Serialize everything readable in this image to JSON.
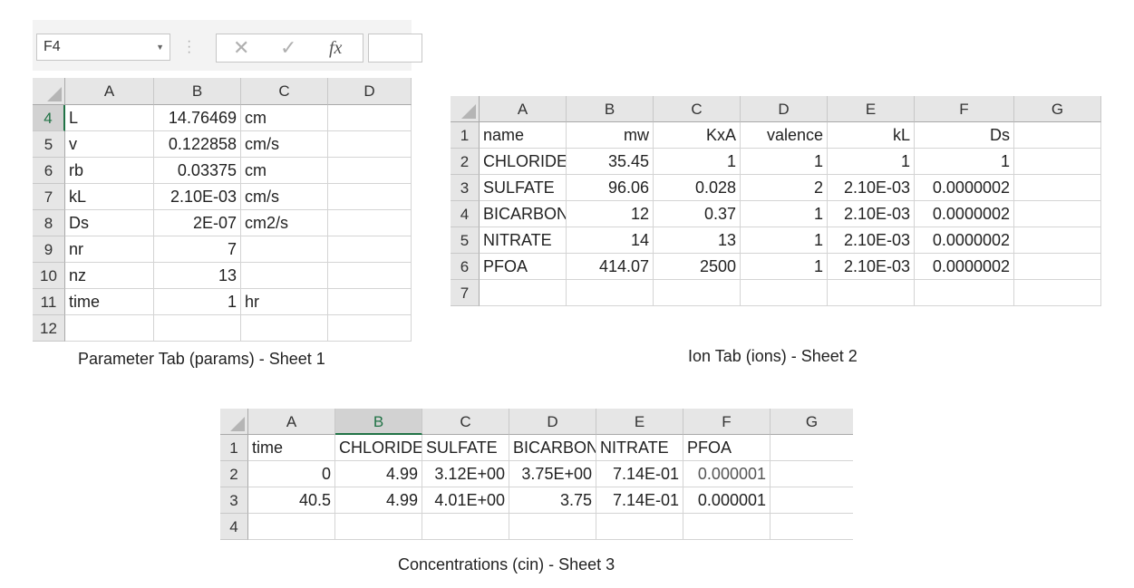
{
  "formula_bar": {
    "name_box": "F4",
    "cancel_glyph": "✕",
    "enter_glyph": "✓",
    "fx_label": "fx"
  },
  "sheet1": {
    "caption": "Parameter Tab (params) - Sheet 1",
    "columns": [
      "A",
      "B",
      "C",
      "D"
    ],
    "rows": [
      {
        "num": "4",
        "A": "L",
        "B": "14.76469",
        "C": "cm"
      },
      {
        "num": "5",
        "A": "v",
        "B": "0.122858",
        "C": "cm/s"
      },
      {
        "num": "6",
        "A": "rb",
        "B": "0.03375",
        "C": "cm"
      },
      {
        "num": "7",
        "A": "kL",
        "B": "2.10E-03",
        "C": "cm/s"
      },
      {
        "num": "8",
        "A": "Ds",
        "B": "2E-07",
        "C": "cm2/s"
      },
      {
        "num": "9",
        "A": "nr",
        "B": "7",
        "C": ""
      },
      {
        "num": "10",
        "A": "nz",
        "B": "13",
        "C": ""
      },
      {
        "num": "11",
        "A": "time",
        "B": "1",
        "C": "hr"
      },
      {
        "num": "12",
        "A": "",
        "B": "",
        "C": ""
      }
    ]
  },
  "sheet2": {
    "caption": "Ion Tab (ions) - Sheet 2",
    "columns": [
      "A",
      "B",
      "C",
      "D",
      "E",
      "F",
      "G"
    ],
    "rows": [
      {
        "num": "1",
        "A": "name",
        "B": "mw",
        "C": "KxA",
        "D": "valence",
        "E": "kL",
        "F": "Ds"
      },
      {
        "num": "2",
        "A": "CHLORIDE",
        "B": "35.45",
        "C": "1",
        "D": "1",
        "E": "1",
        "F": "1"
      },
      {
        "num": "3",
        "A": "SULFATE",
        "B": "96.06",
        "C": "0.028",
        "D": "2",
        "E": "2.10E-03",
        "F": "0.0000002"
      },
      {
        "num": "4",
        "A": "BICARBON",
        "B": "12",
        "C": "0.37",
        "D": "1",
        "E": "2.10E-03",
        "F": "0.0000002"
      },
      {
        "num": "5",
        "A": "NITRATE",
        "B": "14",
        "C": "13",
        "D": "1",
        "E": "2.10E-03",
        "F": "0.0000002"
      },
      {
        "num": "6",
        "A": "PFOA",
        "B": "414.07",
        "C": "2500",
        "D": "1",
        "E": "2.10E-03",
        "F": "0.0000002"
      },
      {
        "num": "7",
        "A": "",
        "B": "",
        "C": "",
        "D": "",
        "E": "",
        "F": ""
      }
    ]
  },
  "sheet3": {
    "caption": "Concentrations (cin) - Sheet 3",
    "columns": [
      "A",
      "B",
      "C",
      "D",
      "E",
      "F",
      "G"
    ],
    "rows": [
      {
        "num": "1",
        "A": "time",
        "B": "CHLORIDE",
        "C": "SULFATE",
        "D": "BICARBON",
        "E": "NITRATE",
        "F": "PFOA"
      },
      {
        "num": "2",
        "A": "0",
        "B": "4.99",
        "C": "3.12E+00",
        "D": "3.75E+00",
        "E": "7.14E-01",
        "F": "0.000001"
      },
      {
        "num": "3",
        "A": "40.5",
        "B": "4.99",
        "C": "4.01E+00",
        "D": "3.75",
        "E": "7.14E-01",
        "F": "0.000001"
      },
      {
        "num": "4",
        "A": "",
        "B": "",
        "C": "",
        "D": "",
        "E": "",
        "F": ""
      }
    ]
  }
}
